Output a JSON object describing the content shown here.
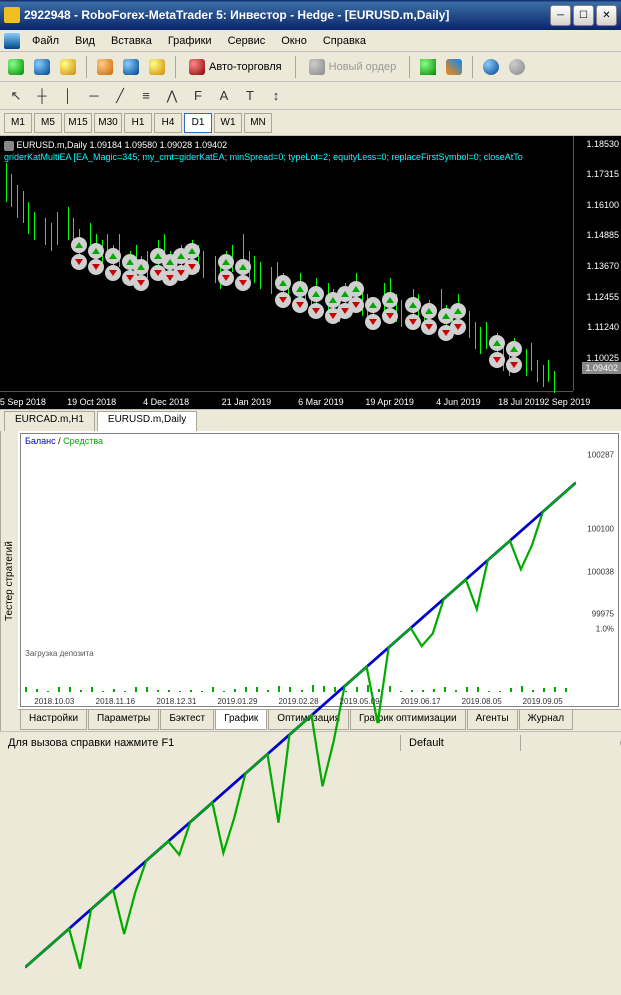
{
  "title": "2922948 - RoboForex-MetaTrader 5: Инвестор - Hedge - [EURUSD.m,Daily]",
  "menu": [
    "Файл",
    "Вид",
    "Вставка",
    "Графики",
    "Сервис",
    "Окно",
    "Справка"
  ],
  "toolbar": {
    "autotrading": "Авто-торговля",
    "neworder": "Новый ордер"
  },
  "drawtools": [
    "↖",
    "┼",
    "│",
    "─",
    "╱",
    "≡",
    "⋀",
    "F",
    "A",
    "T",
    "↕"
  ],
  "timeframes": [
    "M1",
    "M5",
    "M15",
    "M30",
    "H1",
    "H4",
    "D1",
    "W1",
    "MN"
  ],
  "activeTf": "D1",
  "chart": {
    "header": "EURUSD.m,Daily  1.09184 1.09580 1.09028 1.09402",
    "ea": "griderKatMultiEA [EA_Magic=345; my_cmt=giderKatEA; minSpread=0; typeLot=2; equityLess=0; replaceFirstSymbol=0; closeAtTo",
    "pricetag": "1.09402"
  },
  "chart_data": {
    "type": "candlestick",
    "y_labels": [
      {
        "v": "1.18530",
        "p": 3
      },
      {
        "v": "1.17315",
        "p": 15
      },
      {
        "v": "1.16100",
        "p": 27
      },
      {
        "v": "1.14885",
        "p": 39
      },
      {
        "v": "1.13670",
        "p": 51
      },
      {
        "v": "1.12455",
        "p": 63
      },
      {
        "v": "1.11240",
        "p": 75
      },
      {
        "v": "1.10025",
        "p": 87
      }
    ],
    "x_labels": [
      {
        "v": "5 Sep 2018",
        "p": 4
      },
      {
        "v": "19 Oct 2018",
        "p": 16
      },
      {
        "v": "4 Dec 2018",
        "p": 29
      },
      {
        "v": "21 Jan 2019",
        "p": 43
      },
      {
        "v": "6 Mar 2019",
        "p": 56
      },
      {
        "v": "19 Apr 2019",
        "p": 68
      },
      {
        "v": "4 Jun 2019",
        "p": 80
      },
      {
        "v": "18 Jul 2019",
        "p": 91
      },
      {
        "v": "2 Sep 2019",
        "p": 99
      }
    ],
    "candles": [
      {
        "x": 1,
        "lo": 24,
        "hi": 10
      },
      {
        "x": 2,
        "lo": 26,
        "hi": 14
      },
      {
        "x": 3,
        "lo": 30,
        "hi": 18
      },
      {
        "x": 4,
        "lo": 32,
        "hi": 20
      },
      {
        "x": 5,
        "lo": 36,
        "hi": 24
      },
      {
        "x": 6,
        "lo": 38,
        "hi": 28
      },
      {
        "x": 8,
        "lo": 40,
        "hi": 30
      },
      {
        "x": 9,
        "lo": 42,
        "hi": 32
      },
      {
        "x": 10,
        "lo": 40,
        "hi": 28
      },
      {
        "x": 12,
        "lo": 38,
        "hi": 26
      },
      {
        "x": 13,
        "lo": 40,
        "hi": 30
      },
      {
        "x": 14,
        "lo": 44,
        "hi": 34
      },
      {
        "x": 16,
        "lo": 42,
        "hi": 32
      },
      {
        "x": 17,
        "lo": 46,
        "hi": 36
      },
      {
        "x": 18,
        "lo": 48,
        "hi": 38
      },
      {
        "x": 19,
        "lo": 46,
        "hi": 36
      },
      {
        "x": 20,
        "lo": 50,
        "hi": 40
      },
      {
        "x": 21,
        "lo": 48,
        "hi": 36
      },
      {
        "x": 23,
        "lo": 52,
        "hi": 42
      },
      {
        "x": 24,
        "lo": 50,
        "hi": 40
      },
      {
        "x": 25,
        "lo": 54,
        "hi": 44
      },
      {
        "x": 26,
        "lo": 52,
        "hi": 42
      },
      {
        "x": 28,
        "lo": 50,
        "hi": 38
      },
      {
        "x": 29,
        "lo": 48,
        "hi": 36
      },
      {
        "x": 30,
        "lo": 52,
        "hi": 42
      },
      {
        "x": 31,
        "lo": 54,
        "hi": 44
      },
      {
        "x": 32,
        "lo": 50,
        "hi": 40
      },
      {
        "x": 34,
        "lo": 48,
        "hi": 38
      },
      {
        "x": 35,
        "lo": 50,
        "hi": 40
      },
      {
        "x": 36,
        "lo": 52,
        "hi": 42
      },
      {
        "x": 38,
        "lo": 54,
        "hi": 44
      },
      {
        "x": 39,
        "lo": 56,
        "hi": 46
      },
      {
        "x": 40,
        "lo": 52,
        "hi": 42
      },
      {
        "x": 41,
        "lo": 50,
        "hi": 40
      },
      {
        "x": 43,
        "lo": 48,
        "hi": 36
      },
      {
        "x": 44,
        "lo": 52,
        "hi": 42
      },
      {
        "x": 45,
        "lo": 54,
        "hi": 44
      },
      {
        "x": 46,
        "lo": 56,
        "hi": 46
      },
      {
        "x": 48,
        "lo": 58,
        "hi": 48
      },
      {
        "x": 49,
        "lo": 56,
        "hi": 46
      },
      {
        "x": 50,
        "lo": 60,
        "hi": 50
      },
      {
        "x": 51,
        "lo": 62,
        "hi": 52
      },
      {
        "x": 53,
        "lo": 60,
        "hi": 50
      },
      {
        "x": 54,
        "lo": 64,
        "hi": 54
      },
      {
        "x": 55,
        "lo": 66,
        "hi": 56
      },
      {
        "x": 56,
        "lo": 62,
        "hi": 52
      },
      {
        "x": 58,
        "lo": 64,
        "hi": 54
      },
      {
        "x": 59,
        "lo": 66,
        "hi": 56
      },
      {
        "x": 60,
        "lo": 68,
        "hi": 58
      },
      {
        "x": 61,
        "lo": 64,
        "hi": 54
      },
      {
        "x": 63,
        "lo": 62,
        "hi": 50
      },
      {
        "x": 64,
        "lo": 66,
        "hi": 56
      },
      {
        "x": 65,
        "lo": 68,
        "hi": 58
      },
      {
        "x": 66,
        "lo": 70,
        "hi": 60
      },
      {
        "x": 68,
        "lo": 66,
        "hi": 54
      },
      {
        "x": 69,
        "lo": 64,
        "hi": 52
      },
      {
        "x": 70,
        "lo": 68,
        "hi": 58
      },
      {
        "x": 71,
        "lo": 70,
        "hi": 60
      },
      {
        "x": 73,
        "lo": 66,
        "hi": 56
      },
      {
        "x": 74,
        "lo": 68,
        "hi": 58
      },
      {
        "x": 75,
        "lo": 72,
        "hi": 62
      },
      {
        "x": 76,
        "lo": 70,
        "hi": 60
      },
      {
        "x": 78,
        "lo": 68,
        "hi": 56
      },
      {
        "x": 79,
        "lo": 72,
        "hi": 62
      },
      {
        "x": 80,
        "lo": 74,
        "hi": 64
      },
      {
        "x": 81,
        "lo": 70,
        "hi": 58
      },
      {
        "x": 83,
        "lo": 74,
        "hi": 64
      },
      {
        "x": 84,
        "lo": 78,
        "hi": 68
      },
      {
        "x": 85,
        "lo": 80,
        "hi": 70
      },
      {
        "x": 86,
        "lo": 78,
        "hi": 68
      },
      {
        "x": 88,
        "lo": 82,
        "hi": 72
      },
      {
        "x": 89,
        "lo": 86,
        "hi": 76
      },
      {
        "x": 90,
        "lo": 88,
        "hi": 78
      },
      {
        "x": 91,
        "lo": 84,
        "hi": 74
      },
      {
        "x": 93,
        "lo": 88,
        "hi": 78
      },
      {
        "x": 94,
        "lo": 86,
        "hi": 76
      },
      {
        "x": 95,
        "lo": 90,
        "hi": 82
      },
      {
        "x": 96,
        "lo": 92,
        "hi": 84
      },
      {
        "x": 97,
        "lo": 90,
        "hi": 82
      },
      {
        "x": 98,
        "lo": 94,
        "hi": 86
      }
    ],
    "trades": [
      {
        "x": 14,
        "y": 40,
        "t": "buy"
      },
      {
        "x": 14,
        "y": 46,
        "t": "sell"
      },
      {
        "x": 17,
        "y": 42,
        "t": "buy"
      },
      {
        "x": 17,
        "y": 48,
        "t": "sell"
      },
      {
        "x": 20,
        "y": 44,
        "t": "buy"
      },
      {
        "x": 20,
        "y": 50,
        "t": "sell"
      },
      {
        "x": 23,
        "y": 46,
        "t": "buy"
      },
      {
        "x": 23,
        "y": 52,
        "t": "sell"
      },
      {
        "x": 25,
        "y": 48,
        "t": "buy"
      },
      {
        "x": 25,
        "y": 54,
        "t": "sell"
      },
      {
        "x": 28,
        "y": 44,
        "t": "buy"
      },
      {
        "x": 28,
        "y": 50,
        "t": "sell"
      },
      {
        "x": 30,
        "y": 46,
        "t": "buy"
      },
      {
        "x": 30,
        "y": 52,
        "t": "sell"
      },
      {
        "x": 32,
        "y": 44,
        "t": "buy"
      },
      {
        "x": 32,
        "y": 50,
        "t": "sell"
      },
      {
        "x": 34,
        "y": 42,
        "t": "buy"
      },
      {
        "x": 34,
        "y": 48,
        "t": "sell"
      },
      {
        "x": 40,
        "y": 46,
        "t": "buy"
      },
      {
        "x": 40,
        "y": 52,
        "t": "sell"
      },
      {
        "x": 43,
        "y": 48,
        "t": "buy"
      },
      {
        "x": 43,
        "y": 54,
        "t": "sell"
      },
      {
        "x": 50,
        "y": 54,
        "t": "buy"
      },
      {
        "x": 50,
        "y": 60,
        "t": "sell"
      },
      {
        "x": 53,
        "y": 56,
        "t": "buy"
      },
      {
        "x": 53,
        "y": 62,
        "t": "sell"
      },
      {
        "x": 56,
        "y": 58,
        "t": "buy"
      },
      {
        "x": 56,
        "y": 64,
        "t": "sell"
      },
      {
        "x": 59,
        "y": 60,
        "t": "buy"
      },
      {
        "x": 59,
        "y": 66,
        "t": "sell"
      },
      {
        "x": 61,
        "y": 58,
        "t": "buy"
      },
      {
        "x": 61,
        "y": 64,
        "t": "sell"
      },
      {
        "x": 63,
        "y": 56,
        "t": "buy"
      },
      {
        "x": 63,
        "y": 62,
        "t": "sell"
      },
      {
        "x": 66,
        "y": 62,
        "t": "buy"
      },
      {
        "x": 66,
        "y": 68,
        "t": "sell"
      },
      {
        "x": 69,
        "y": 60,
        "t": "buy"
      },
      {
        "x": 69,
        "y": 66,
        "t": "sell"
      },
      {
        "x": 73,
        "y": 62,
        "t": "buy"
      },
      {
        "x": 73,
        "y": 68,
        "t": "sell"
      },
      {
        "x": 76,
        "y": 64,
        "t": "buy"
      },
      {
        "x": 76,
        "y": 70,
        "t": "sell"
      },
      {
        "x": 79,
        "y": 66,
        "t": "buy"
      },
      {
        "x": 79,
        "y": 72,
        "t": "sell"
      },
      {
        "x": 81,
        "y": 64,
        "t": "buy"
      },
      {
        "x": 81,
        "y": 70,
        "t": "sell"
      },
      {
        "x": 88,
        "y": 76,
        "t": "buy"
      },
      {
        "x": 88,
        "y": 82,
        "t": "sell"
      },
      {
        "x": 91,
        "y": 78,
        "t": "buy"
      },
      {
        "x": 91,
        "y": 84,
        "t": "sell"
      }
    ]
  },
  "chartTabs": [
    {
      "label": "EURCAD.m,H1",
      "active": false
    },
    {
      "label": "EURUSD.m,Daily",
      "active": true
    }
  ],
  "tester": {
    "sidebarLabel": "Тестер стратегий",
    "legend_balance": "Баланс",
    "legend_equity": "Средства",
    "depositLabel": "Загрузка депозита",
    "y_labels": [
      {
        "v": "100287",
        "p": 10
      },
      {
        "v": "100100",
        "p": 45
      },
      {
        "v": "100038",
        "p": 65
      },
      {
        "v": "99975",
        "p": 85
      }
    ],
    "y2_labels": [
      {
        "v": "1.0%",
        "p": 92
      }
    ],
    "x_labels": [
      {
        "v": "2018.10.03",
        "p": 6
      },
      {
        "v": "2018.11.16",
        "p": 17
      },
      {
        "v": "2018.12.31",
        "p": 28
      },
      {
        "v": "2019.01.29",
        "p": 39
      },
      {
        "v": "2019.02.28",
        "p": 50
      },
      {
        "v": "2019.05.09",
        "p": 61
      },
      {
        "v": "2019.06.17",
        "p": 72
      },
      {
        "v": "2019.08.05",
        "p": 83
      },
      {
        "v": "2019.09.05",
        "p": 94
      }
    ],
    "tabs": [
      "Настройки",
      "Параметры",
      "Бэктест",
      "График",
      "Оптимизация",
      "График оптимизации",
      "Агенты",
      "Журнал"
    ],
    "activeTab": "График"
  },
  "status": {
    "help": "Для вызова справки нажмите F1",
    "profile": "Default"
  }
}
